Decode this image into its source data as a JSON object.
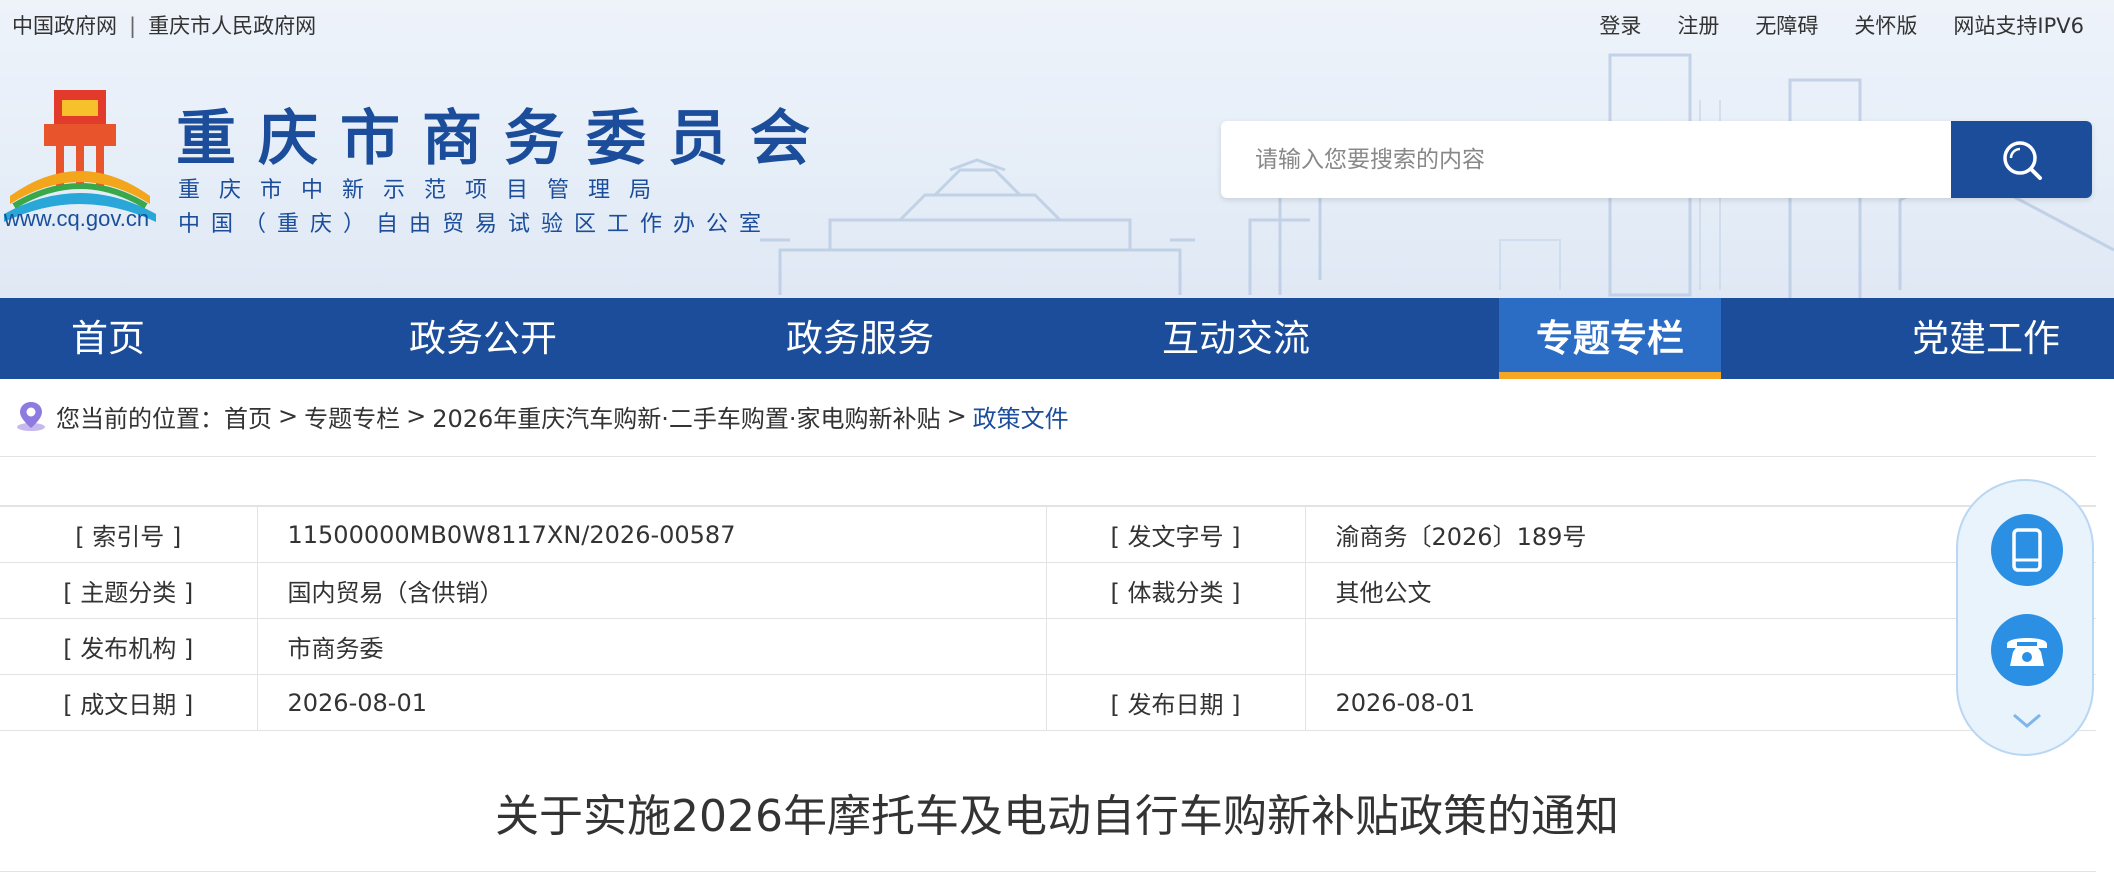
{
  "top_links_left": [
    "中国政府网",
    "|",
    "重庆市人民政府网"
  ],
  "top_links_right": [
    "登录",
    "注册",
    "无障碍",
    "关怀版",
    "网站支持IPV6"
  ],
  "site": {
    "url": "www.cq.gov.cn",
    "title": "重庆市商务委员会",
    "subtitle1": "重庆市中新示范项目管理局",
    "subtitle2": "中国（重庆）自由贸易试验区工作办公室"
  },
  "search": {
    "placeholder": "请输入您要搜索的内容",
    "icon": "search-icon"
  },
  "nav": [
    {
      "label": "首页",
      "active": false
    },
    {
      "label": "政务公开",
      "active": false
    },
    {
      "label": "政务服务",
      "active": false
    },
    {
      "label": "互动交流",
      "active": false
    },
    {
      "label": "专题专栏",
      "active": true
    },
    {
      "label": "党建工作",
      "active": false
    }
  ],
  "breadcrumb": {
    "prefix": "您当前的位置：",
    "items": [
      "首页",
      "专题专栏",
      "2026年重庆汽车购新·二手车购置·家电购新补贴"
    ],
    "current": "政策文件",
    "separator": ">"
  },
  "meta": [
    {
      "l1": "[ 索引号 ]",
      "v1": "11500000MB0W8117XN/2026-00587",
      "l2": "[ 发文字号 ]",
      "v2": "渝商务〔2026〕189号"
    },
    {
      "l1": "[ 主题分类 ]",
      "v1": "国内贸易（含供销）",
      "l2": "[ 体裁分类 ]",
      "v2": "其他公文"
    },
    {
      "l1": "[ 发布机构 ]",
      "v1": "市商务委",
      "l2": "",
      "v2": ""
    },
    {
      "l1": "[ 成文日期 ]",
      "v1": "2026-08-01",
      "l2": "[ 发布日期 ]",
      "v2": "2026-08-01"
    }
  ],
  "doc_title": "关于实施2026年摩托车及电动自行车购新补贴政策的通知",
  "colors": {
    "brand": "#1b4d9b",
    "active_underline": "#f5a623",
    "float_button": "#2b8fe3"
  }
}
